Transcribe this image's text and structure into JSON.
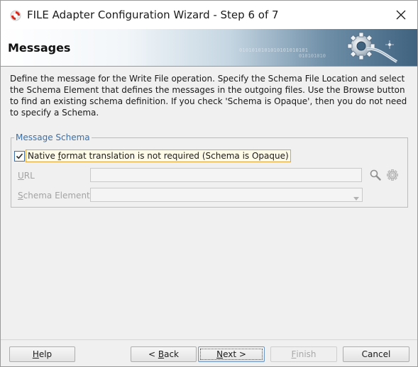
{
  "window": {
    "title": "FILE Adapter Configuration Wizard - Step 6 of 7",
    "icon": "oracle-adapter-icon",
    "close_icon": "close-icon"
  },
  "banner": {
    "title": "Messages",
    "decor_text": "0101010101010101010101",
    "decor_text2": "010101010"
  },
  "description": "Define the message for the Write File operation.  Specify the Schema File Location and select the Schema Element that defines the messages in the outgoing files. Use the Browse button to find an existing schema definition. If you check 'Schema is Opaque', then you do not need to specify a Schema.",
  "message_schema": {
    "legend": "Message Schema",
    "opaque_checkbox": {
      "checked": true,
      "label_prefix": "Native ",
      "label_mnemonic": "f",
      "label_suffix": "ormat translation is not required (Schema is Opaque)"
    },
    "url": {
      "label_mnemonic": "U",
      "label_suffix": "RL",
      "value": "",
      "search_icon": "search-icon",
      "generate_icon": "gear-icon"
    },
    "schema_element": {
      "label_mnemonic": "S",
      "label_suffix": "chema Element",
      "value": "",
      "dropdown_icon": "chevron-down-icon"
    }
  },
  "buttons": {
    "help": {
      "mnemonic": "H",
      "rest": "elp"
    },
    "back": {
      "prefix": "< ",
      "mnemonic": "B",
      "rest": "ack"
    },
    "next": {
      "mnemonic": "N",
      "rest": "ext >"
    },
    "finish": {
      "mnemonic": "F",
      "rest": "inish",
      "enabled": false
    },
    "cancel": {
      "label": "Cancel"
    }
  },
  "colors": {
    "legend": "#3b6fa6",
    "checkbox_focus": "#e3a33d",
    "banner_dark": "#3f627f"
  }
}
